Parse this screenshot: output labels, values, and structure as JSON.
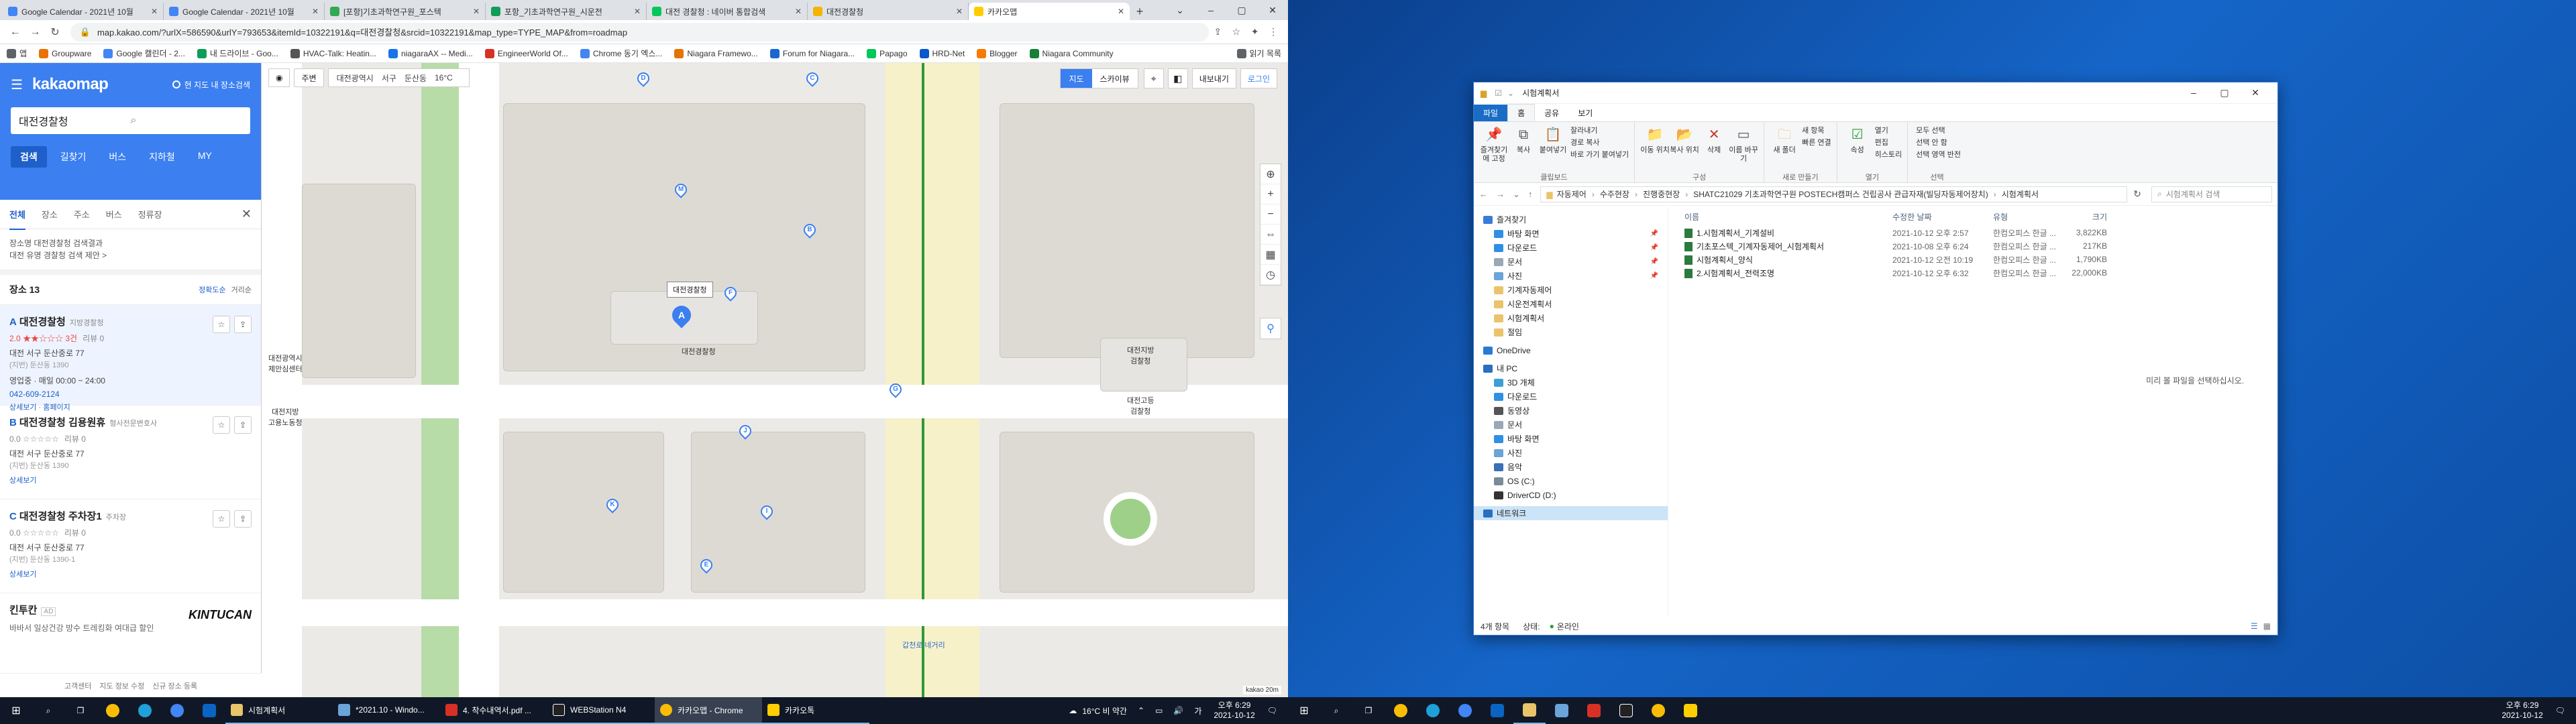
{
  "browser": {
    "tabs": [
      {
        "title": "Google Calendar - 2021년 10월",
        "color": "#4285f4"
      },
      {
        "title": "Google Calendar - 2021년 10월",
        "color": "#4285f4"
      },
      {
        "title": "[포항]기초과학연구원_포스텍",
        "color": "#34a853"
      },
      {
        "title": "포항_기초과학연구원_시운전",
        "color": "#0f9d58"
      },
      {
        "title": "대전 경찰청 : 네이버 통합검색",
        "color": "#03c75a"
      },
      {
        "title": "대전경찰청",
        "color": "#f4b400"
      },
      {
        "title": "카카오맵",
        "color": "#ffcd00"
      }
    ],
    "new_tab": "+",
    "url": "map.kakao.com/?urlX=586590&urlY=793653&itemId=10322191&q=대전경찰청&srcid=10322191&map_type=TYPE_MAP&from=roadmap",
    "bookmarks": [
      {
        "label": "앱",
        "color": "#5f6368"
      },
      {
        "label": "Groupware",
        "color": "#e8710a"
      },
      {
        "label": "Google 캘린더 - 2...",
        "color": "#4285f4"
      },
      {
        "label": "내 드라이브 - Goo...",
        "color": "#0f9d58"
      },
      {
        "label": "HVAC-Talk: Heatin...",
        "color": "#555555"
      },
      {
        "label": "niagaraAX -- Medi...",
        "color": "#1a73e8"
      },
      {
        "label": "EngineerWorld Of...",
        "color": "#d93025"
      },
      {
        "label": "Chrome 동기 엑스...",
        "color": "#4285f4"
      },
      {
        "label": "Niagara Framewo...",
        "color": "#e37400"
      },
      {
        "label": "Forum for Niagara...",
        "color": "#1967d2"
      },
      {
        "label": "Papago",
        "color": "#03c75a"
      },
      {
        "label": "HRD-Net",
        "color": "#0b57d0"
      },
      {
        "label": "Blogger",
        "color": "#f57c00"
      },
      {
        "label": "Niagara Community",
        "color": "#188038"
      }
    ],
    "reading_list": "읽기 목록"
  },
  "kakao": {
    "logo": "kakaomap",
    "option": "현 지도 내 장소검색",
    "search_value": "대전경찰청",
    "tabs": [
      "검색",
      "길찾기",
      "버스",
      "지하철",
      "MY"
    ],
    "subtabs": [
      "전체",
      "장소",
      "주소",
      "버스",
      "정류장"
    ],
    "info_line1": "장소명 대전경찰청 검색결과",
    "info_line1_hl": "대전경찰청",
    "info_line2": "대전 유명 경찰청 검색 제안 >",
    "count_label": "장소 13",
    "sort_accuracy": "정확도순",
    "sort_distance": "거리순",
    "places": [
      {
        "letter": "A",
        "name": "대전경찰청",
        "cat": "지방경찰청",
        "rating": "2.0 ★★☆☆☆ 3건",
        "reviews": "리뷰 0",
        "addr": "대전 서구 둔산중로 77",
        "addr2": "(지번) 둔산동 1390",
        "hours": "영업중 · 매일 00:00 ~ 24:00",
        "tel": "042-609-2124",
        "links": "상세보기 · 홈페이지"
      },
      {
        "letter": "B",
        "name": "대전경찰청 김용원휴",
        "cat": "형사전문변호사",
        "rating": "0.0 ☆☆☆☆☆",
        "reviews": "리뷰 0",
        "addr": "대전 서구 둔산중로 77",
        "addr2": "(지번) 둔산동 1390",
        "hours": "",
        "tel": "",
        "links": "상세보기"
      },
      {
        "letter": "C",
        "name": "대전경찰청 주차장1",
        "cat": "주차장",
        "rating": "0.0 ☆☆☆☆☆",
        "reviews": "리뷰 0",
        "addr": "대전 서구 둔산중로 77",
        "addr2": "(지번) 둔산동 1390-1",
        "hours": "",
        "tel": "",
        "links": "상세보기"
      }
    ],
    "ad": {
      "title": "킨투칸",
      "tag": "AD",
      "desc": "바바서 일상건강 방수 트레킹화 여대급 할인",
      "logo": "KINTUCAN"
    },
    "footer": [
      "고객센터",
      "지도 정보 수정",
      "신규 장소 등록"
    ]
  },
  "map": {
    "top_btn1": "주변",
    "crumbs": [
      "대전광역시",
      "서구",
      "둔산동",
      "16°C"
    ],
    "seg": [
      "지도",
      "스카이뷰"
    ],
    "right_txt": [
      "내보내기",
      "로그인"
    ],
    "bubble": "대전경찰청",
    "labels": {
      "police": "대전경찰청",
      "metro": "대전광역시\n제안심센터",
      "edu": "대전지방\n검찰청",
      "court": "대전고등\n검찰청",
      "school": "대전지방\n고용노동청",
      "road": "갑천로 네거리",
      "scale": "kakao",
      "scale_val": "20m"
    },
    "pins": [
      "A",
      "B",
      "C",
      "D",
      "E",
      "F",
      "G",
      "I",
      "J",
      "K",
      "M"
    ]
  },
  "explorer": {
    "title": "시험계획서",
    "ribbon_tabs": [
      "파일",
      "홈",
      "공유",
      "보기"
    ],
    "groups": [
      {
        "label": "클립보드",
        "buttons": [
          "즐겨찾기에 고정",
          "복사",
          "붙여넣기"
        ],
        "small": [
          "잘라내기",
          "경로 복사",
          "바로 가기 붙여넣기"
        ]
      },
      {
        "label": "구성",
        "buttons": [
          "이동 위치",
          "복사 위치",
          "삭제",
          "이름 바꾸기"
        ],
        "small": []
      },
      {
        "label": "새로 만들기",
        "buttons": [
          "새 폴더"
        ],
        "small": [
          "새 항목",
          "빠른 연결"
        ]
      },
      {
        "label": "열기",
        "buttons": [
          "속성"
        ],
        "small": [
          "열기",
          "편집",
          "히스토리"
        ]
      },
      {
        "label": "선택",
        "buttons": [],
        "small": [
          "모두 선택",
          "선택 안 함",
          "선택 영역 반전"
        ]
      }
    ],
    "path": [
      "자동제어",
      "수주현장",
      "진행중현장",
      "SHATC21029 기초과학연구원 POSTECH캠퍼스 건립공사 관급자재(빌딩자동제어장치)",
      "시험계획서"
    ],
    "search_placeholder": "시험계획서 검색",
    "nav": [
      {
        "label": "즐겨찾기",
        "color": "#3a7bd5",
        "pin": false
      },
      {
        "label": "바탕 화면",
        "color": "#2f8fe5",
        "pin": true
      },
      {
        "label": "다운로드",
        "color": "#2f8fe5",
        "pin": true
      },
      {
        "label": "문서",
        "color": "#9aa7b5",
        "pin": true
      },
      {
        "label": "사진",
        "color": "#6aa4d8",
        "pin": true
      },
      {
        "label": "기계자동제어",
        "color": "#e9c46a",
        "pin": false
      },
      {
        "label": "시운전계획서",
        "color": "#e9c46a",
        "pin": false
      },
      {
        "label": "시험계획서",
        "color": "#e9c46a",
        "pin": false
      },
      {
        "label": "절임",
        "color": "#e9c46a",
        "pin": false
      },
      {
        "label": "OneDrive",
        "color": "#2a7ad4",
        "pin": false
      },
      {
        "label": "내 PC",
        "color": "#2a6fc0",
        "pin": false
      },
      {
        "label": "3D 개체",
        "color": "#3aa0d6",
        "pin": false
      },
      {
        "label": "다운로드",
        "color": "#2f8fe5",
        "pin": false
      },
      {
        "label": "동영상",
        "color": "#555555",
        "pin": false
      },
      {
        "label": "문서",
        "color": "#9aa7b5",
        "pin": false
      },
      {
        "label": "바탕 화면",
        "color": "#2f8fe5",
        "pin": false
      },
      {
        "label": "사진",
        "color": "#6aa4d8",
        "pin": false
      },
      {
        "label": "음악",
        "color": "#3b6fb6",
        "pin": false
      },
      {
        "label": "OS (C:)",
        "color": "#7a8a99",
        "pin": false
      },
      {
        "label": "DriverCD (D:)",
        "color": "#333333",
        "pin": false
      },
      {
        "label": "네트워크",
        "color": "#2a6fc0",
        "pin": false
      }
    ],
    "columns": [
      "이름",
      "수정한 날짜",
      "유형",
      "크기"
    ],
    "files": [
      {
        "name": "1.시험계획서_기계설비",
        "date": "2021-10-12 오후 2:57",
        "type": "한컴오피스 한글 ...",
        "size": "3,822KB"
      },
      {
        "name": "기초포스텍_기계자동제어_시험계획서",
        "date": "2021-10-08 오후 6:24",
        "type": "한컴오피스 한글 ...",
        "size": "217KB"
      },
      {
        "name": "시험계획서_양식",
        "date": "2021-10-12 오전 10:19",
        "type": "한컴오피스 한글 ...",
        "size": "1,790KB"
      },
      {
        "name": "2.시험계획서_전력조명",
        "date": "2021-10-12 오후 6:32",
        "type": "한컴오피스 한글 ...",
        "size": "22,000KB"
      }
    ],
    "preview": "미리 볼 파일을 선택하십시오.",
    "status_count": "4개 항목",
    "status_label": "상태:",
    "status_val": "온라인"
  },
  "taskbar_left": {
    "apps": [
      {
        "label": "시험계획서",
        "color": "#e9c46a"
      },
      {
        "label": "*2021.10 - Windo...",
        "color": "#6aa4d8"
      },
      {
        "label": "4. 착수내역서.pdf ...",
        "color": "#d93025"
      },
      {
        "label": "WEBStation N4",
        "color": "#222222"
      },
      {
        "label": "카카오맵 - Chrome",
        "color": "#fbbc05"
      },
      {
        "label": "카카오톡",
        "color": "#ffcd00"
      }
    ],
    "weather": "16°C 비 약간",
    "time": "오후 6:29",
    "date": "2021-10-12"
  },
  "taskbar_right": {
    "time": "오후 6:29",
    "date": "2021-10-12"
  }
}
